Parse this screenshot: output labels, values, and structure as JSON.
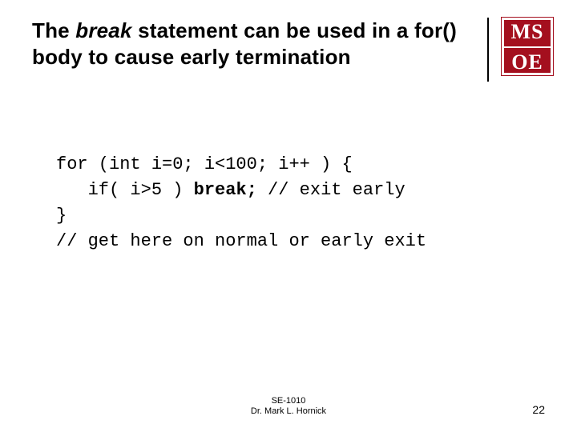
{
  "title": {
    "prefix": "The ",
    "em": "break",
    "suffix": " statement can be used in a for() body to cause early termination"
  },
  "logo": {
    "top": "MS",
    "bottom": "OE"
  },
  "code": {
    "l1a": "for (int i=0; i<100; i++ ) {",
    "l2a": "   if( i>5 ) ",
    "l2b": "break;",
    "l2c": " // exit early",
    "l3": "}",
    "l4": "// get here on normal or early exit"
  },
  "footer": {
    "line1": "SE-1010",
    "line2": "Dr. Mark L. Hornick"
  },
  "page": "22"
}
